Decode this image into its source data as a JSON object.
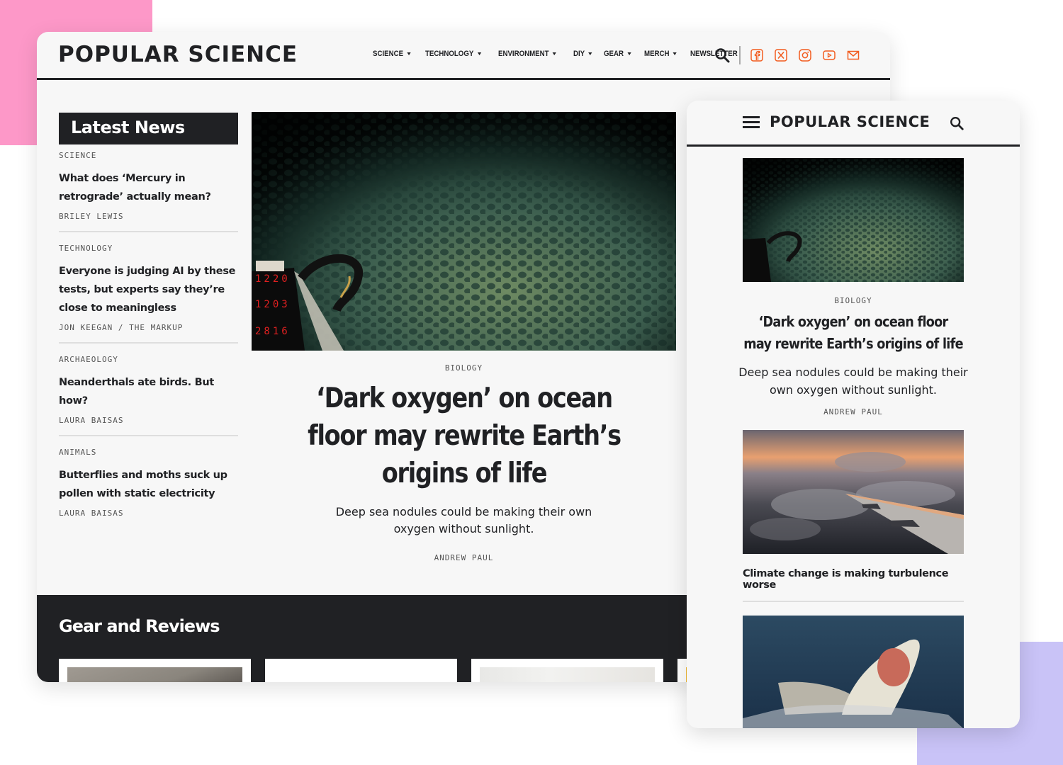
{
  "colors": {
    "brand_dark": "#202124",
    "social_accent": "#f25c1f",
    "deco_pink": "#fd98c8",
    "deco_purple": "#c9c3f7"
  },
  "desktop": {
    "logo": "POPULAR SCIENCE",
    "nav": [
      {
        "label": "SCIENCE",
        "has_dropdown": true
      },
      {
        "label": "TECHNOLOGY",
        "has_dropdown": true
      },
      {
        "label": "ENVIRONMENT",
        "has_dropdown": true
      },
      {
        "label": "DIY",
        "has_dropdown": true
      },
      {
        "label": "GEAR",
        "has_dropdown": true
      },
      {
        "label": "MERCH",
        "has_dropdown": true
      },
      {
        "label": "NEWSLETTER",
        "has_dropdown": false
      }
    ],
    "header_icons": [
      "search-icon",
      "facebook-icon",
      "x-icon",
      "instagram-icon",
      "youtube-icon",
      "email-icon"
    ],
    "latest_news": {
      "title": "Latest News",
      "items": [
        {
          "category": "SCIENCE",
          "headline": "What does ‘Mercury in retrograde’ actually mean?",
          "author": "BRILEY LEWIS"
        },
        {
          "category": "TECHNOLOGY",
          "headline": "Everyone is judging AI by these tests, but experts say they’re close to meaningless",
          "author": "JON KEEGAN / THE MARKUP"
        },
        {
          "category": "ARCHAEOLOGY",
          "headline": "Neanderthals ate birds. But how?",
          "author": "LAURA BAISAS"
        },
        {
          "category": "ANIMALS",
          "headline": "Butterflies and moths suck up pollen with static electricity",
          "author": "LAURA BAISAS"
        }
      ]
    },
    "hero": {
      "image": "deep-sea-nodules-photo",
      "image_readout": [
        "1220",
        "1203",
        "2816"
      ],
      "category": "BIOLOGY",
      "headline": "‘Dark oxygen’ on ocean floor may rewrite Earth’s origins of life",
      "dek": "Deep sea nodules could be making their own oxygen without sunlight.",
      "author": "ANDREW PAUL"
    },
    "gear": {
      "title": "Gear and Reviews",
      "cards": [
        "gear-card-1",
        "gear-card-2",
        "gear-card-3",
        "gear-card-4"
      ]
    }
  },
  "mobile": {
    "logo": "POPULAR SCIENCE",
    "featured": {
      "image": "deep-sea-nodules-photo",
      "category": "BIOLOGY",
      "headline": "‘Dark oxygen’ on ocean floor may rewrite Earth’s origins of life",
      "dek": "Deep sea nodules could be making their own oxygen without sunlight.",
      "author": "ANDREW PAUL"
    },
    "stories": [
      {
        "image": "airplane-wing-clouds-photo",
        "headline": "Climate change is making turbulence worse"
      },
      {
        "image": "breaching-shark-photo",
        "headline": ""
      }
    ]
  }
}
